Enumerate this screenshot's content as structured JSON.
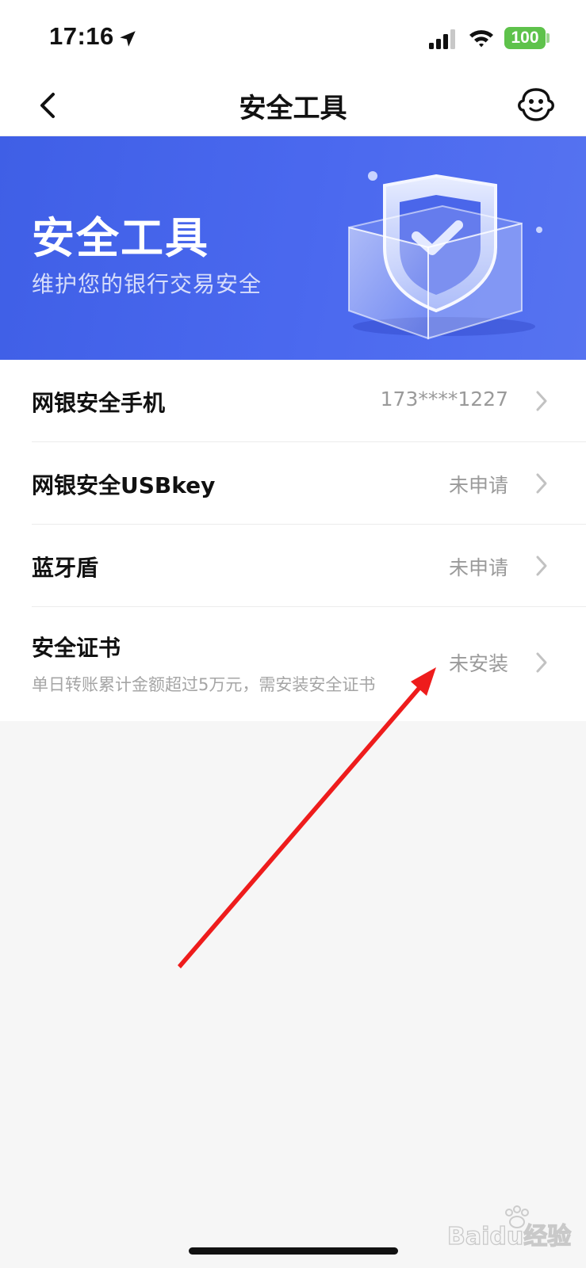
{
  "status_bar": {
    "time": "17:16",
    "battery": "100",
    "icons": [
      "location-arrow-icon",
      "cellular-signal-icon",
      "wifi-icon",
      "battery-icon"
    ]
  },
  "nav": {
    "title": "安全工具",
    "back_icon": "chevron-left-icon",
    "service_icon": "customer-service-icon"
  },
  "banner": {
    "title": "安全工具",
    "subtitle": "维护您的银行交易安全",
    "illustration": "shield-check-box-icon"
  },
  "list": [
    {
      "label": "网银安全手机",
      "value": "173****1227"
    },
    {
      "label": "网银安全USBkey",
      "value": "未申请"
    },
    {
      "label": "蓝牙盾",
      "value": "未申请"
    },
    {
      "label": "安全证书",
      "value": "未安装",
      "hint": "单日转账累计金额超过5万元，需安装安全证书"
    }
  ],
  "colors": {
    "banner_blue": "#4b69ef",
    "battery_green": "#5ec24b",
    "annotation_red": "#ee1c1c"
  },
  "watermark": "Baidu经验"
}
